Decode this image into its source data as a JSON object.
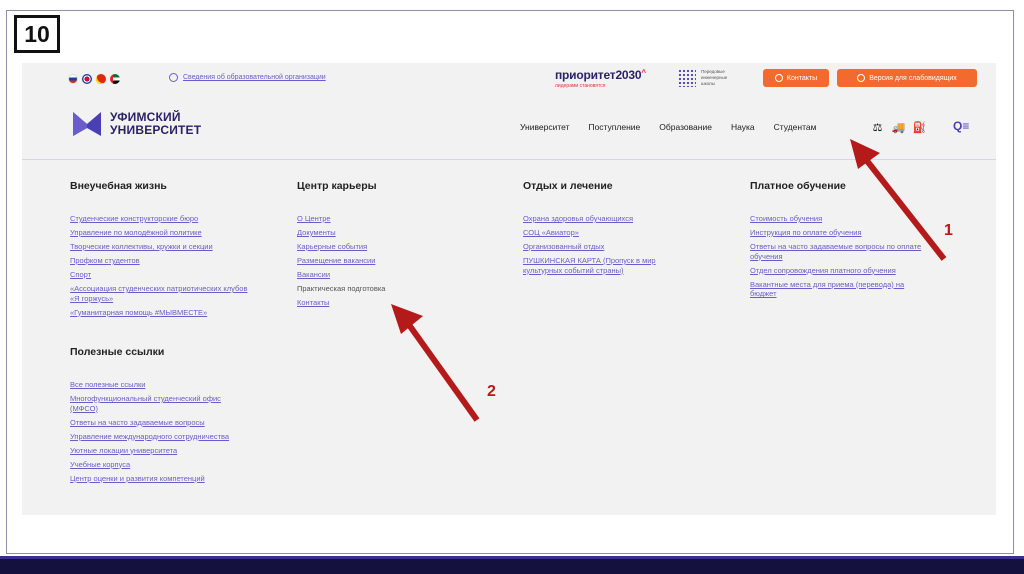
{
  "slide": {
    "number": "10"
  },
  "top_strip": {
    "flags": [
      {
        "name": "russia-flag-icon",
        "color": "#d52b1e"
      },
      {
        "name": "uk-flag-icon",
        "color": "#c8102e"
      },
      {
        "name": "china-flag-icon",
        "color": "#de2910"
      },
      {
        "name": "uae-flag-icon",
        "color": "#00732f"
      }
    ],
    "info_link": "Сведения об образовательной организации",
    "priority_title": "приоритет2030",
    "priority_superscript": "^",
    "priority_sub": "лидерами становятся",
    "engineering_text": "Передовые инженерные школы",
    "contacts_button": "Контакты",
    "vision_button": "Версия для слабовидящих"
  },
  "header": {
    "logo_line1": "УФИМСКИЙ",
    "logo_line2": "УНИВЕРСИТЕТ",
    "nav": [
      "Университет",
      "Поступление",
      "Образование",
      "Наука",
      "Студентам"
    ]
  },
  "menu": {
    "col1": {
      "title": "Внеучебная жизнь",
      "links": [
        "Студенческие конструкторские бюро",
        "Управление по молодёжной политике",
        "Творческие коллективы, кружки и секции",
        "Профком студентов",
        "Спорт",
        "«Ассоциация студенческих патриотических клубов «Я горжусь»",
        "«Гуманитарная помощь #МЫВМЕСТЕ»"
      ]
    },
    "col2": {
      "title": "Центр карьеры",
      "links": [
        "О Центре",
        "Документы",
        "Карьерные события",
        "Размещение вакансии",
        "Вакансии",
        "Практическая подготовка",
        "Контакты"
      ]
    },
    "col3": {
      "title": "Отдых и лечение",
      "links": [
        "Охрана здоровья обучающихся",
        "СОЦ «Авиатор»",
        "Организованный отдых",
        "ПУШКИНСКАЯ КАРТА (Пропуск в мир культурных событий страны)"
      ]
    },
    "col4": {
      "title": "Платное обучение",
      "links": [
        "Стоимость обучения",
        "Инструкция по оплате обучения",
        "Ответы на часто задаваемые вопросы по оплате обучения",
        "Отдел сопровождения платного обучения",
        "Вакантные места для приема (перевода) на бюджет"
      ]
    },
    "col5": {
      "title": "Полезные ссылки",
      "links": [
        "Все полезные ссылки",
        "Многофункциональный студенческий офис (МФСО)",
        "Ответы на часто задаваемые вопросы",
        "Управление международного сотрудничества",
        "Уютные локации университета",
        "Учебные корпуса",
        "Центр оценки и развития компетенций"
      ]
    }
  },
  "annotations": {
    "arrow1_label": "1",
    "arrow2_label": "2",
    "arrow_color": "#b51a1a"
  }
}
